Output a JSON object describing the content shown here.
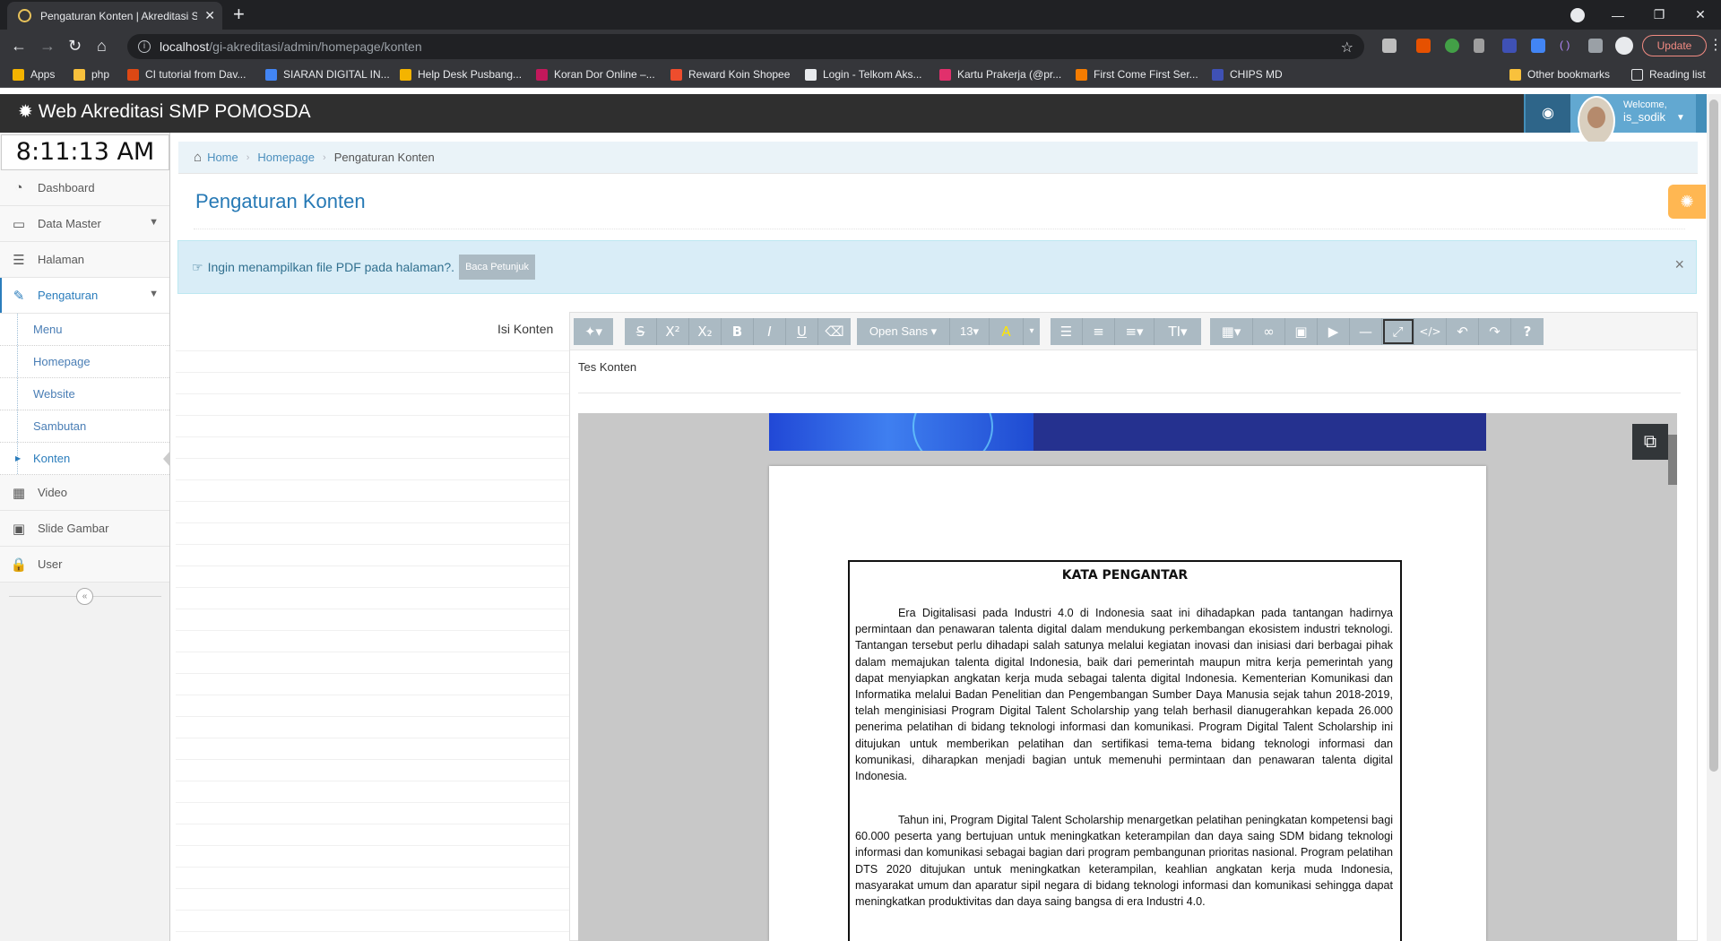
{
  "browser": {
    "tab_title": "Pengaturan Konten | Akreditasi S",
    "url_host": "localhost",
    "url_path": "/gi-akreditasi/admin/homepage/konten",
    "update_label": "Update",
    "bookmarks": [
      {
        "label": "Apps",
        "color": "#f4b400"
      },
      {
        "label": "php",
        "color": "#f9c13c"
      },
      {
        "label": "CI tutorial from Dav...",
        "color": "#dd4814"
      },
      {
        "label": "SIARAN DIGITAL IN...",
        "color": "#4285f4"
      },
      {
        "label": "Help Desk Pusbang...",
        "color": "#f4b400"
      },
      {
        "label": "Koran Dor Online –...",
        "color": "#c2185b"
      },
      {
        "label": "Reward Koin Shopee",
        "color": "#ee4d2d"
      },
      {
        "label": "Login - Telkom Aks...",
        "color": "#e8eaed"
      },
      {
        "label": "Kartu Prakerja (@pr...",
        "color": "#e1306c"
      },
      {
        "label": "First Come First Ser...",
        "color": "#f57c00"
      },
      {
        "label": "CHIPS MD",
        "color": "#3f51b5"
      }
    ],
    "other_bookmarks": "Other bookmarks",
    "reading_list": "Reading list"
  },
  "app": {
    "brand": "Web Akreditasi SMP POMOSDA",
    "welcome": "Welcome,",
    "username": "is_sodik",
    "clock": "8:11:13 AM"
  },
  "sidebar": {
    "items": [
      {
        "label": "Dashboard",
        "icon": "tachometer-icon"
      },
      {
        "label": "Data Master",
        "icon": "folder-open-icon"
      },
      {
        "label": "Halaman",
        "icon": "list-alt-icon"
      },
      {
        "label": "Pengaturan",
        "icon": "wrench-icon"
      },
      {
        "label": "Video",
        "icon": "film-icon"
      },
      {
        "label": "Slide Gambar",
        "icon": "picture-icon"
      },
      {
        "label": "User",
        "icon": "lock-icon"
      }
    ],
    "sub_items": [
      "Menu",
      "Homepage",
      "Website",
      "Sambutan",
      "Konten"
    ]
  },
  "breadcrumb": {
    "home": "Home",
    "parent": "Homepage",
    "current": "Pengaturan Konten"
  },
  "page": {
    "title": "Pengaturan Konten",
    "alert_text": "Ingin menampilkan file PDF pada halaman?.",
    "alert_button": "Baca Petunjuk",
    "form_label": "Isi Konten"
  },
  "editor": {
    "font_name": "Open Sans",
    "font_size": "13",
    "content_text": "Tes Konten"
  },
  "pdf": {
    "heading": "KATA PENGANTAR",
    "para1": "Era Digitalisasi pada Industri 4.0 di Indonesia saat ini dihadapkan pada tantangan hadirnya permintaan dan penawaran talenta digital dalam mendukung perkembangan ekosistem industri teknologi. Tantangan tersebut perlu dihadapi salah satunya melalui kegiatan inovasi dan inisiasi dari berbagai pihak dalam memajukan talenta digital Indonesia, baik dari pemerintah maupun mitra kerja pemerintah yang dapat menyiapkan angkatan kerja muda sebagai talenta digital Indonesia. Kementerian Komunikasi dan Informatika melalui Badan Penelitian dan Pengembangan Sumber Daya Manusia sejak tahun 2018-2019, telah menginisiasi Program Digital Talent Scholarship yang telah berhasil  dianugerahkan kepada 26.000 penerima pelatihan di bidang teknologi informasi dan komunikasi. Program Digital Talent Scholarship ini ditujukan untuk memberikan pelatihan dan sertifikasi tema-tema bidang teknologi informasi dan komunikasi, diharapkan menjadi bagian untuk memenuhi permintaan dan penawaran talenta digital Indonesia.",
    "para2": "Tahun ini, Program Digital Talent Scholarship menargetkan pelatihan peningkatan kompetensi bagi 60.000 peserta yang bertujuan untuk meningkatkan keterampilan dan daya saing SDM bidang teknologi informasi dan komunikasi sebagai bagian dari program pembangunan prioritas nasional. Program pelatihan DTS 2020 ditujukan untuk meningkatkan keterampilan, keahlian angkatan kerja muda Indonesia, masyarakat umum dan aparatur sipil negara di bidang teknologi informasi dan komunikasi sehingga dapat meningkatkan produktivitas dan daya saing bangsa di era Industri 4.0."
  },
  "colors": {
    "header": "#2f2f2f",
    "accent": "#438eb9",
    "title": "#2679b5",
    "alert_bg": "#d9edf7",
    "settings": "#ffb752"
  }
}
